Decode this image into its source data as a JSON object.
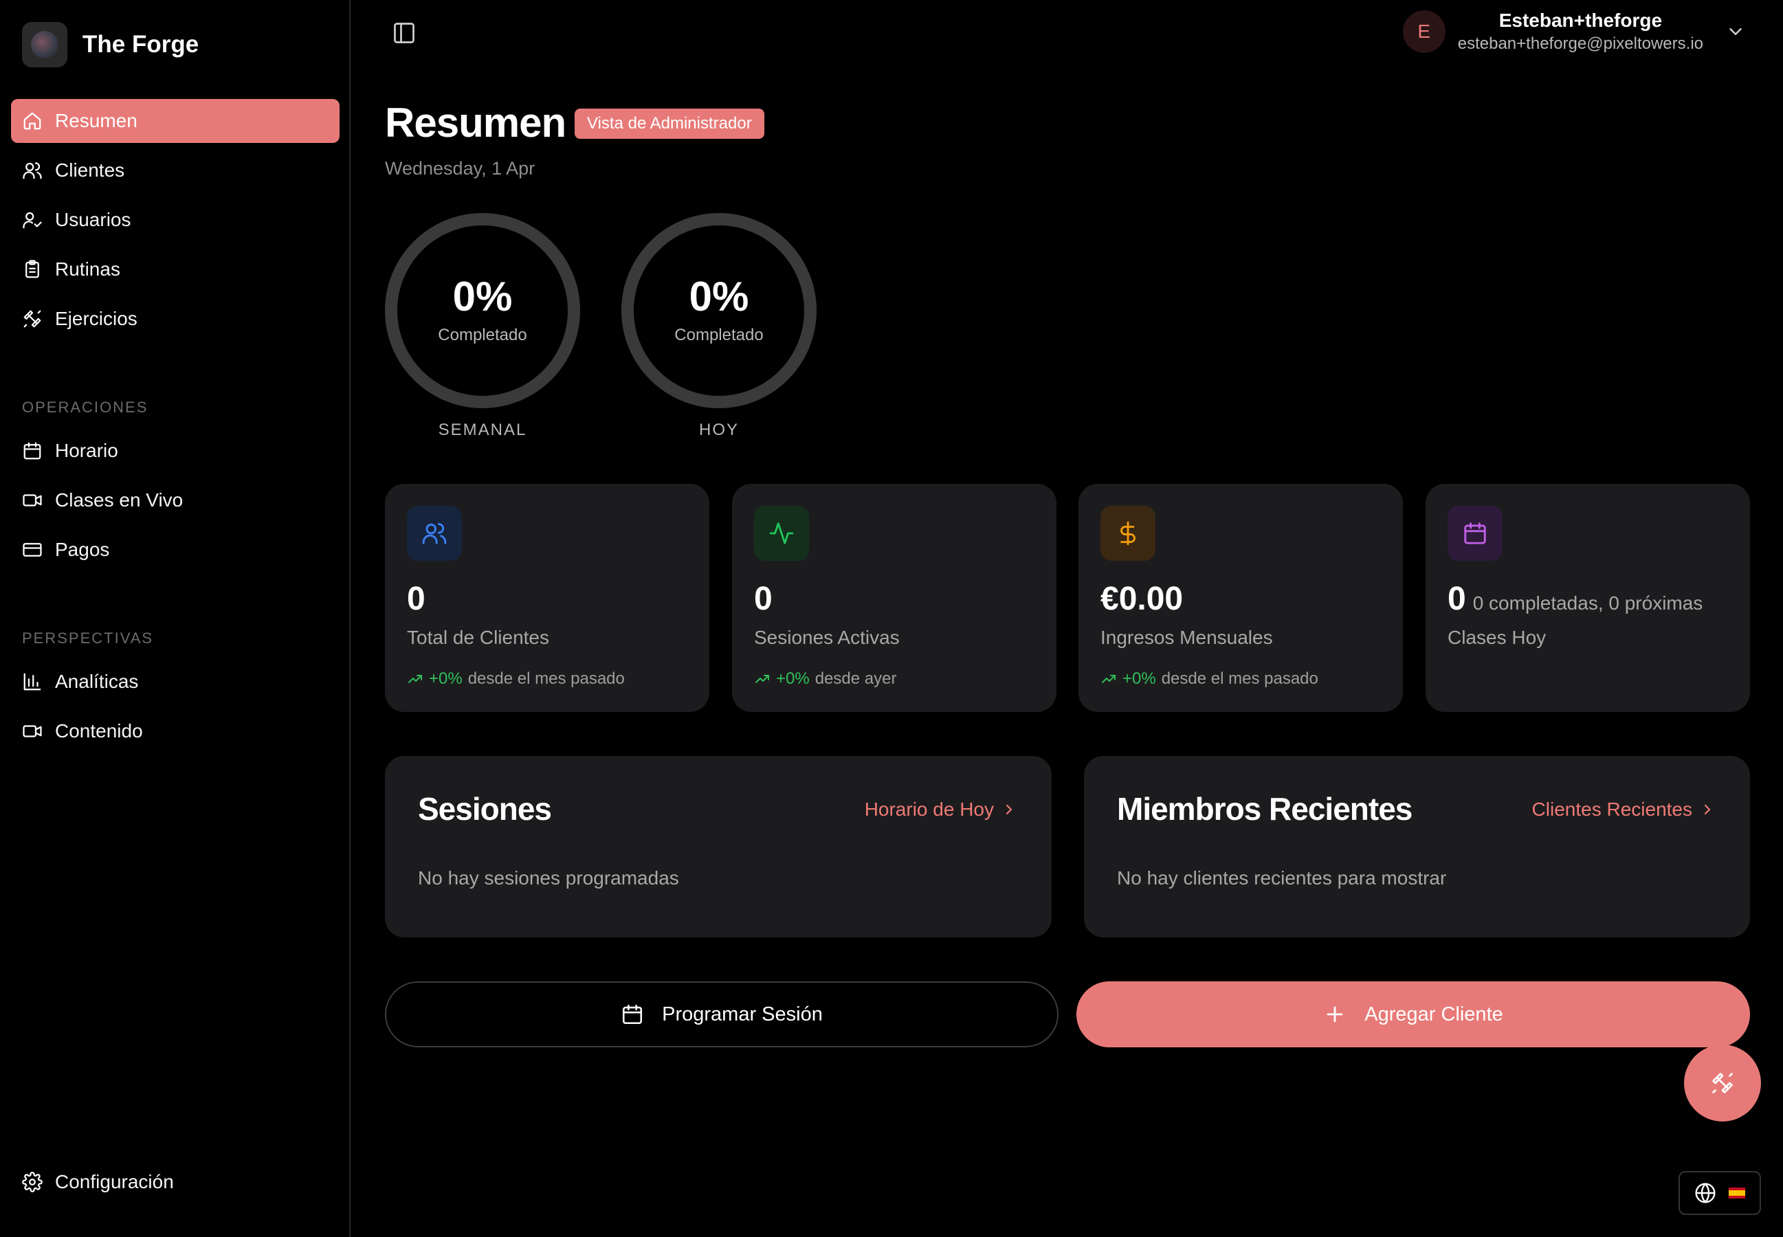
{
  "brand": {
    "name": "The Forge"
  },
  "sidebar": {
    "items": [
      {
        "label": "Resumen",
        "icon": "home-icon",
        "active": true
      },
      {
        "label": "Clientes",
        "icon": "users-icon"
      },
      {
        "label": "Usuarios",
        "icon": "user-check-icon"
      },
      {
        "label": "Rutinas",
        "icon": "clipboard-list-icon"
      },
      {
        "label": "Ejercicios",
        "icon": "dumbbell-icon"
      }
    ],
    "operations_label": "OPERACIONES",
    "operations": [
      {
        "label": "Horario",
        "icon": "calendar-icon"
      },
      {
        "label": "Clases en Vivo",
        "icon": "video-icon"
      },
      {
        "label": "Pagos",
        "icon": "credit-card-icon"
      }
    ],
    "insights_label": "PERSPECTIVAS",
    "insights": [
      {
        "label": "Analíticas",
        "icon": "bar-chart-icon"
      },
      {
        "label": "Contenido",
        "icon": "video-icon"
      }
    ],
    "settings_label": "Configuración"
  },
  "user": {
    "initial": "E",
    "name": "Esteban+theforge",
    "email": "esteban+theforge@pixeltowers.io"
  },
  "page": {
    "title": "Resumen",
    "badge": "Vista de Administrador",
    "date": "Wednesday, 1 Apr"
  },
  "rings": [
    {
      "value": "0%",
      "sub": "Completado",
      "label": "SEMANAL",
      "progress": 0
    },
    {
      "value": "0%",
      "sub": "Completado",
      "label": "HOY",
      "progress": 0
    }
  ],
  "stats": [
    {
      "value": "0",
      "label": "Total de Clientes",
      "trend_pct": "+0%",
      "trend_text": "desde el mes pasado",
      "icon": "users-icon",
      "color": "#3b82f6",
      "bg": "#16243d"
    },
    {
      "value": "0",
      "label": "Sesiones Activas",
      "trend_pct": "+0%",
      "trend_text": "desde ayer",
      "icon": "activity-icon",
      "color": "#22c55e",
      "bg": "#14301c"
    },
    {
      "value": "€0.00",
      "label": "Ingresos Mensuales",
      "trend_pct": "+0%",
      "trend_text": "desde el mes pasado",
      "icon": "dollar-icon",
      "color": "#f59e0b",
      "bg": "#3a2812"
    },
    {
      "value": "0",
      "extra": "0 completadas, 0 próximas",
      "label": "Clases Hoy",
      "icon": "calendar-icon",
      "color": "#c060e8",
      "bg": "#2e1a3a"
    }
  ],
  "panels": {
    "sessions": {
      "title": "Sesiones",
      "link": "Horario de Hoy",
      "empty": "No hay sesiones programadas"
    },
    "members": {
      "title": "Miembros Recientes",
      "link": "Clientes Recientes",
      "empty": "No hay clientes recientes para mostrar"
    }
  },
  "actions": {
    "schedule": "Programar Sesión",
    "add_client": "Agregar Cliente"
  },
  "colors": {
    "accent": "#e77a78",
    "trend_green": "#2fbf5a",
    "card_bg": "#1c1c1e"
  }
}
